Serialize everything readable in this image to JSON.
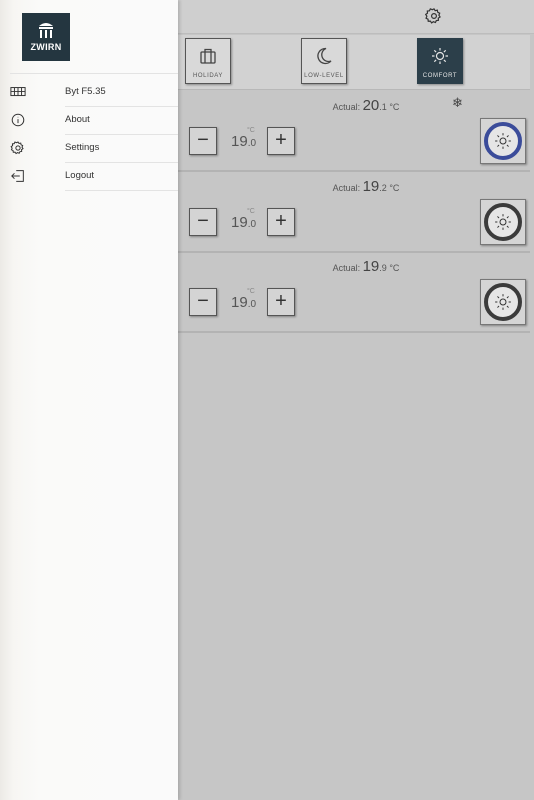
{
  "drawer": {
    "logo_text": "ZWIRN",
    "items": [
      {
        "label": "Byt F5.35",
        "icon": "apartment-map-icon"
      },
      {
        "label": "About",
        "icon": "info-icon"
      },
      {
        "label": "Settings",
        "icon": "gear-icon"
      },
      {
        "label": "Logout",
        "icon": "logout-icon"
      }
    ]
  },
  "modes": [
    {
      "label": "HOLIDAY",
      "icon": "suitcase-icon",
      "active": false
    },
    {
      "label": "LOW-LEVEL",
      "icon": "moon-icon",
      "active": false
    },
    {
      "label": "COMFORT",
      "icon": "sun-icon",
      "active": true
    }
  ],
  "zones": [
    {
      "actual_label": "Actual:",
      "actual_int": "20",
      "actual_dec": ".1",
      "actual_unit": "°C",
      "setpoint_int": "19",
      "setpoint_dec": ".0",
      "setpoint_unit": "°C",
      "minus": "−",
      "plus": "+",
      "dial_color": "#3b4c9a"
    },
    {
      "actual_label": "Actual:",
      "actual_int": "19",
      "actual_dec": ".2",
      "actual_unit": "°C",
      "setpoint_int": "19",
      "setpoint_dec": ".0",
      "setpoint_unit": "°C",
      "minus": "−",
      "plus": "+",
      "dial_color": "#3b3b3b"
    },
    {
      "actual_label": "Actual:",
      "actual_int": "19",
      "actual_dec": ".9",
      "actual_unit": "°C",
      "setpoint_int": "19",
      "setpoint_dec": ".0",
      "setpoint_unit": "°C",
      "minus": "−",
      "plus": "+",
      "dial_color": "#3b3b3b"
    }
  ],
  "snowflake": "❄",
  "colors": {
    "active_mode": "#2c3f4a",
    "logo_bg": "#243640"
  }
}
